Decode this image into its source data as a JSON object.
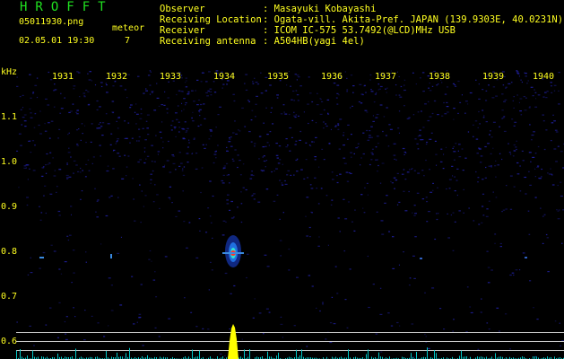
{
  "header": {
    "title": "HROFFT",
    "file_name": "05011930.png",
    "datetime": "02.05.01 19:30",
    "meteor_label": "meteor",
    "meteor_count": "7"
  },
  "info": [
    {
      "key": "Observer",
      "value": ": Masayuki Kobayashi"
    },
    {
      "key": "Receiving Location",
      "value": ": Ogata-vill. Akita-Pref. JAPAN (139.9303E, 40.0231N)"
    },
    {
      "key": "Receiver",
      "value": ": ICOM IC-575 53.7492(@LCD)MHz USB"
    },
    {
      "key": "Receiving antenna",
      "value": ": A504HB(yagi 4el)"
    }
  ],
  "axis": {
    "y_unit": "kHz",
    "y_ticks": [
      "1.1",
      "1.0",
      "0.9",
      "0.8",
      "0.7",
      "0.6"
    ],
    "x_ticks": [
      "1931",
      "1932",
      "1933",
      "1934",
      "1935",
      "1936",
      "1937",
      "1938",
      "1939",
      "1940"
    ]
  },
  "colors": {
    "header_text": "#ffff20",
    "title_text": "#20e020",
    "noise": "#2020a0",
    "signal": "#ffff00",
    "spectrum_small": "#00c8c8",
    "marker_lines": "#c8c8c8"
  }
}
